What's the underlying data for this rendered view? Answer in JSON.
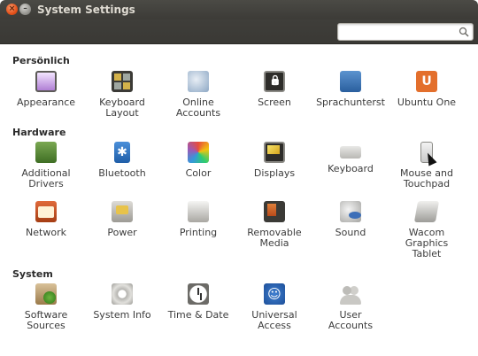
{
  "window": {
    "title": "System Settings"
  },
  "search": {
    "value": "",
    "placeholder": ""
  },
  "sections": {
    "personal": {
      "title": "Persönlich",
      "items": [
        "Appearance",
        "Keyboard\nLayout",
        "Online\nAccounts",
        "Screen",
        "Sprachunterst",
        "Ubuntu One"
      ]
    },
    "hardware": {
      "title": "Hardware",
      "items": [
        "Additional\nDrivers",
        "Bluetooth",
        "Color",
        "Displays",
        "Keyboard",
        "Mouse and\nTouchpad",
        "Network",
        "Power",
        "Printing",
        "Removable\nMedia",
        "Sound",
        "Wacom\nGraphics\nTablet"
      ]
    },
    "system": {
      "title": "System",
      "items": [
        "Software\nSources",
        "System Info",
        "Time & Date",
        "Universal\nAccess",
        "User\nAccounts"
      ]
    }
  },
  "icons": {
    "ubuntu_one_glyph": "U",
    "bluetooth_glyph": "✱",
    "universal_glyph": "☺"
  }
}
